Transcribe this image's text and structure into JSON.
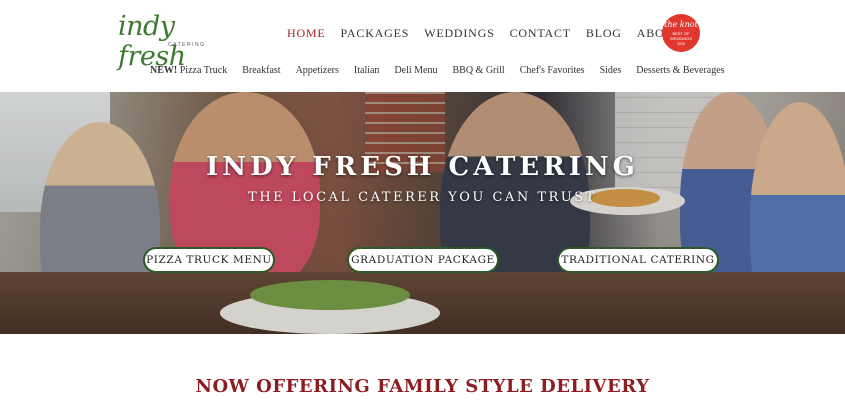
{
  "brand": {
    "logo_text_main": "indy fresh",
    "logo_text_sub": "CATERING",
    "color_green": "#3d7a2f",
    "color_red": "#a3262a"
  },
  "main_nav": {
    "items": [
      {
        "label": "HOME",
        "active": true
      },
      {
        "label": "PACKAGES",
        "active": false
      },
      {
        "label": "WEDDINGS",
        "active": false
      },
      {
        "label": "CONTACT",
        "active": false
      },
      {
        "label": "BLOG",
        "active": false
      },
      {
        "label": "ABOUT",
        "active": false
      }
    ]
  },
  "badge": {
    "line1": "the knot",
    "line2": "BEST OF WEDDINGS",
    "line3": "2020",
    "color": "#e0382f"
  },
  "sub_nav": {
    "items": [
      {
        "prefix": "NEW!",
        "label": " Pizza Truck"
      },
      {
        "label": "Breakfast"
      },
      {
        "label": "Appetizers"
      },
      {
        "label": "Italian"
      },
      {
        "label": "Deli Menu"
      },
      {
        "label": "BBQ & Grill"
      },
      {
        "label": "Chef's Favorites"
      },
      {
        "label": "Sides"
      },
      {
        "label": "Desserts & Beverages"
      }
    ]
  },
  "hero": {
    "title": "INDY FRESH CATERING",
    "subtitle": "THE LOCAL CATERER YOU CAN TRUST",
    "buttons": [
      {
        "label": "PIZZA TRUCK MENU"
      },
      {
        "label": "GRADUATION PACKAGE"
      },
      {
        "label": "TRADITIONAL CATERING"
      }
    ],
    "button_border_color": "#2d5a27"
  },
  "section": {
    "title": "NOW OFFERING FAMILY STYLE DELIVERY"
  }
}
